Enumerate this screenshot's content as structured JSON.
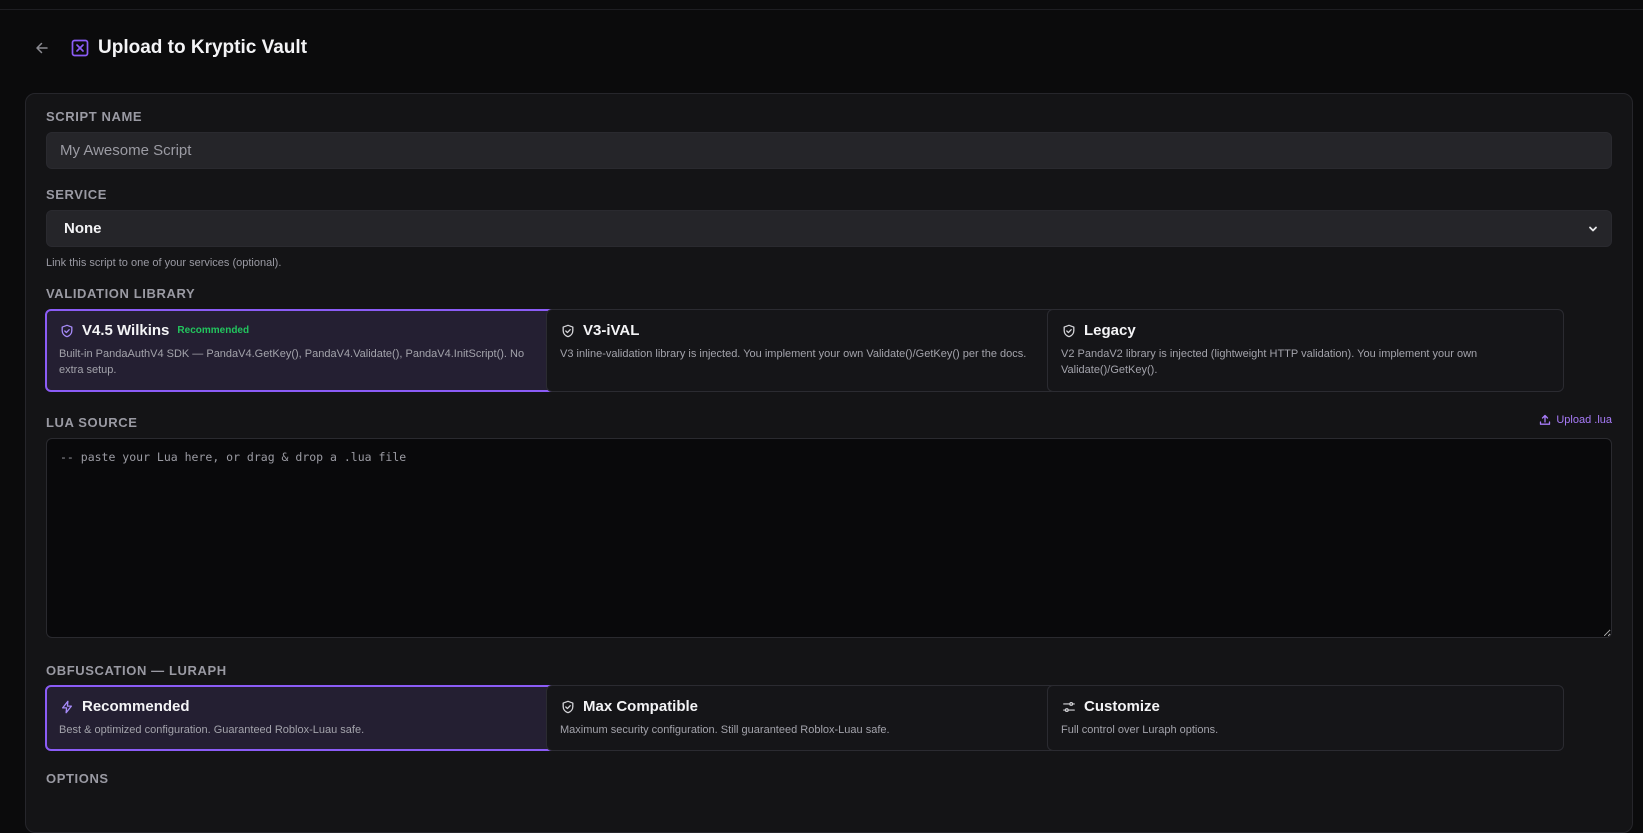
{
  "header": {
    "title": "Upload to Kryptic Vault"
  },
  "script_name": {
    "label": "SCRIPT NAME",
    "placeholder": "My Awesome Script",
    "value": ""
  },
  "service": {
    "label": "SERVICE",
    "selected": "None",
    "helper": "Link this script to one of your services (optional)."
  },
  "validation": {
    "label": "VALIDATION LIBRARY",
    "options": [
      {
        "title": "V4.5 Wilkins",
        "badge": "Recommended",
        "desc": "Built-in PandaAuthV4 SDK — PandaV4.GetKey(), PandaV4.Validate(), PandaV4.InitScript(). No extra setup.",
        "icon": "shield-check-icon",
        "selected": true
      },
      {
        "title": "V3-iVAL",
        "desc": "V3 inline-validation library is injected. You implement your own Validate()/GetKey() per the docs.",
        "icon": "shield-check-icon",
        "selected": false
      },
      {
        "title": "Legacy",
        "desc": "V2 PandaV2 library is injected (lightweight HTTP validation). You implement your own Validate()/GetKey().",
        "icon": "shield-check-icon",
        "selected": false
      }
    ]
  },
  "lua_source": {
    "label": "LUA SOURCE",
    "upload_label": "Upload .lua",
    "placeholder": "-- paste your Lua here, or drag & drop a .lua file"
  },
  "obfuscation": {
    "label": "OBFUSCATION — LURAPH",
    "options": [
      {
        "title": "Recommended",
        "desc": "Best & optimized configuration. Guaranteed Roblox-Luau safe.",
        "icon": "lightning-icon",
        "selected": true
      },
      {
        "title": "Max Compatible",
        "desc": "Maximum security configuration. Still guaranteed Roblox-Luau safe.",
        "icon": "shield-check-icon",
        "selected": false
      },
      {
        "title": "Customize",
        "desc": "Full control over Luraph options.",
        "icon": "sliders-icon",
        "selected": false
      }
    ]
  },
  "options": {
    "label": "OPTIONS"
  },
  "colors": {
    "accent": "#8b5cf6",
    "recommended_badge": "#22c55e",
    "background": "#0b0b0c",
    "card": "#141416"
  }
}
